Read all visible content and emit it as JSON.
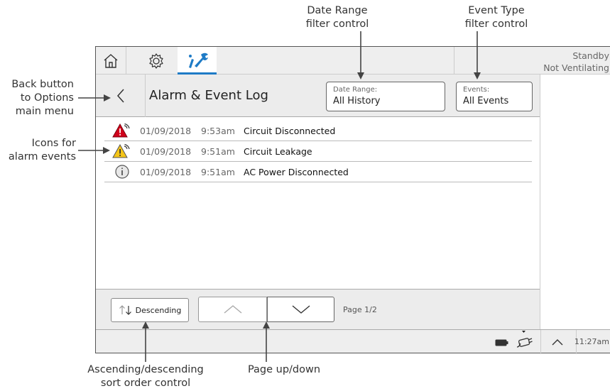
{
  "callouts": {
    "date_range": [
      "Date Range",
      "filter control"
    ],
    "event_type": [
      "Event Type",
      "filter control"
    ],
    "back": [
      "Back button",
      "to Options",
      "main menu"
    ],
    "icons": [
      "Icons for",
      "alarm events"
    ],
    "sort": [
      "Ascending/descending",
      "sort order control"
    ],
    "paging": [
      "Page up/down"
    ]
  },
  "topbar": {
    "tabs": [
      {
        "icon": "home-icon"
      },
      {
        "icon": "gear-icon"
      },
      {
        "icon": "tools-icon",
        "active": true
      }
    ],
    "status_line1": "Standby",
    "status_line2": "Not Ventilating"
  },
  "header": {
    "title": "Alarm & Event Log",
    "date_filter": {
      "caption": "Date Range:",
      "value": "All History"
    },
    "event_filter": {
      "caption": "Events:",
      "value": "All Events"
    }
  },
  "events": [
    {
      "icon": "red-alarm-icon",
      "date": "01/09/2018",
      "time": "9:53am",
      "message": "Circuit Disconnected"
    },
    {
      "icon": "yellow-alarm-icon",
      "date": "01/09/2018",
      "time": "9:51am",
      "message": "Circuit Leakage"
    },
    {
      "icon": "info-icon",
      "date": "01/09/2018",
      "time": "9:51am",
      "message": "AC Power Disconnected"
    }
  ],
  "footer": {
    "sort_label": "Descending",
    "page_label": "Page 1/2"
  },
  "bottombar": {
    "clock": "11:27am"
  },
  "colors": {
    "accent": "#1e7bc6",
    "alarm_high": "#d0021b",
    "alarm_medium": "#f5c518"
  }
}
